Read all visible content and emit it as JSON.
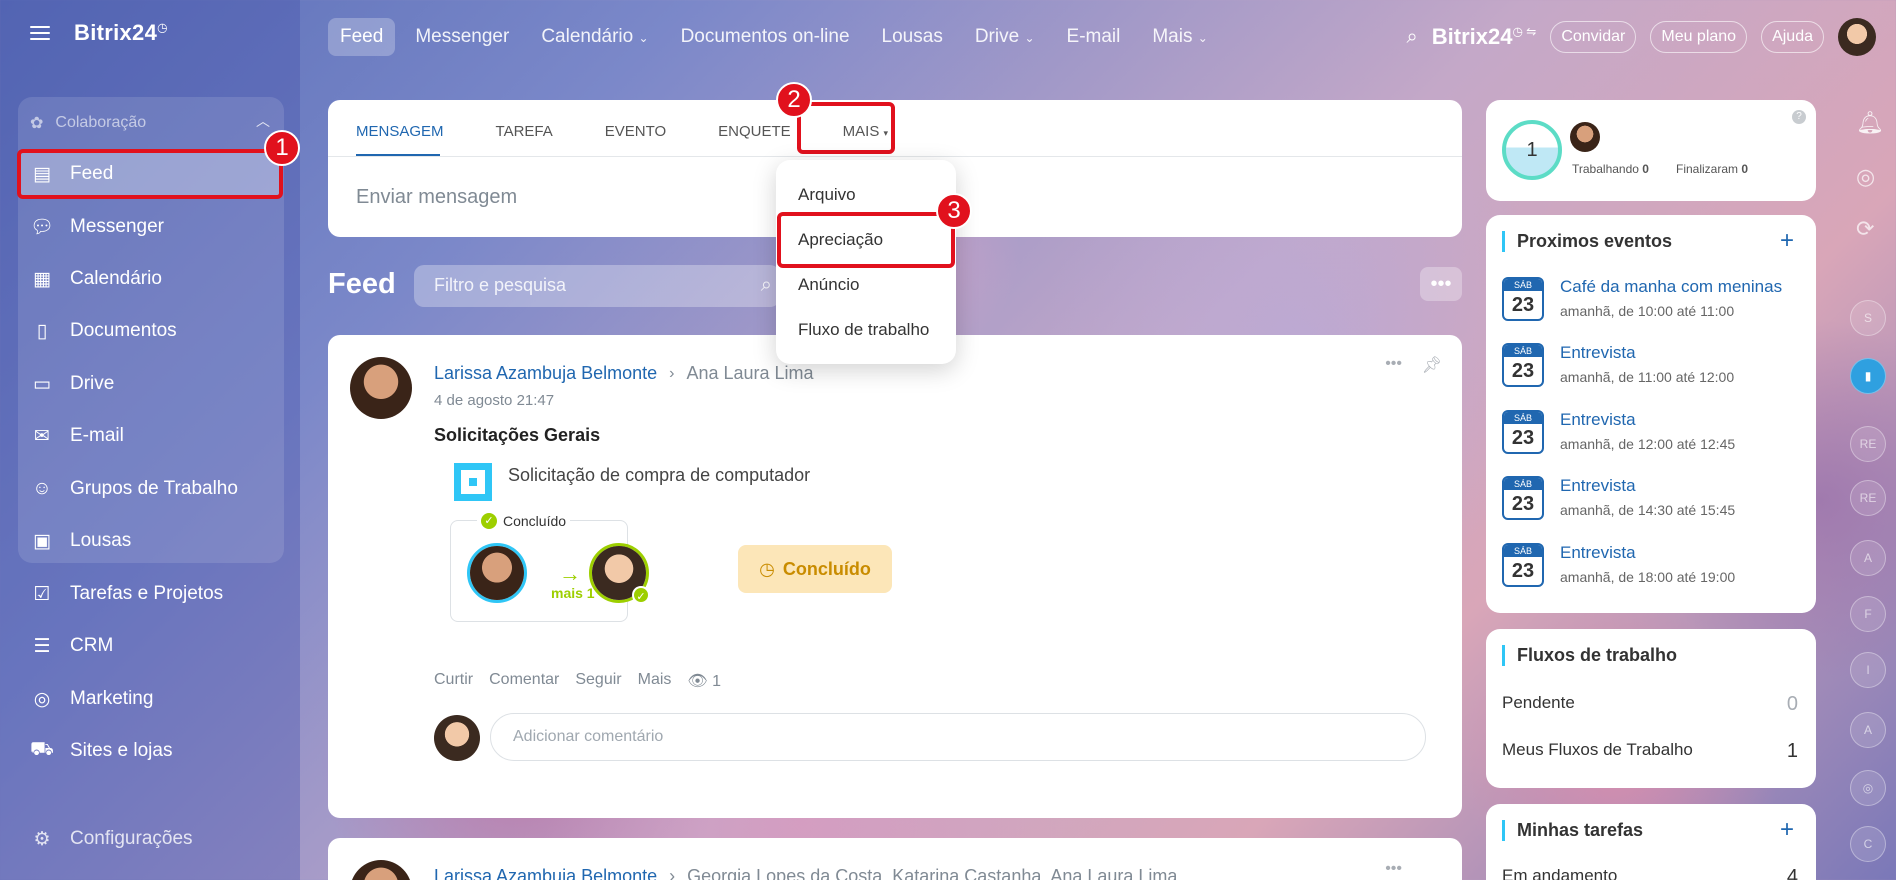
{
  "app": {
    "logo": "Bitrix24"
  },
  "sidebar": {
    "group_title": "Colaboração",
    "items": [
      {
        "label": "Feed"
      },
      {
        "label": "Messenger"
      },
      {
        "label": "Calendário"
      },
      {
        "label": "Documentos"
      },
      {
        "label": "Drive"
      },
      {
        "label": "E-mail"
      },
      {
        "label": "Grupos de Trabalho"
      },
      {
        "label": "Lousas"
      },
      {
        "label": "Tarefas e Projetos"
      },
      {
        "label": "CRM"
      },
      {
        "label": "Marketing"
      },
      {
        "label": "Sites e lojas"
      }
    ],
    "settings": "Configurações"
  },
  "topnav": {
    "items": [
      "Feed",
      "Messenger",
      "Calendário",
      "Documentos on-line",
      "Lousas",
      "Drive",
      "E-mail",
      "Mais"
    ],
    "logo": "Bitrix24",
    "invite": "Convidar",
    "plan": "Meu plano",
    "help": "Ajuda"
  },
  "composer": {
    "tabs": [
      "MENSAGEM",
      "TAREFA",
      "EVENTO",
      "ENQUETE",
      "MAIS"
    ],
    "placeholder": "Enviar mensagem"
  },
  "dropdown": {
    "items": [
      "Arquivo",
      "Apreciação",
      "Anúncio",
      "Fluxo de trabalho"
    ]
  },
  "callouts": [
    "1",
    "2",
    "3"
  ],
  "feed": {
    "title": "Feed",
    "search_placeholder": "Filtro e pesquisa",
    "post": {
      "author": "Larissa Azambuja Belmonte",
      "recipient": "Ana Laura Lima",
      "date": "4 de agosto 21:47",
      "title": "Solicitações Gerais",
      "item": "Solicitação de compra de computador",
      "status_card_label": "Concluído",
      "more_label": "mais 1",
      "status_badge": "Concluído",
      "actions": [
        "Curtir",
        "Comentar",
        "Seguir",
        "Mais"
      ],
      "views": "1",
      "comment_placeholder": "Adicionar comentário"
    },
    "post2": {
      "author": "Larissa Azambuja Belmonte",
      "recipients": "Georgia Lopes da Costa, Katarina Castanha, Ana Laura Lima"
    }
  },
  "worktime": {
    "count": "1",
    "working_label": "Trabalhando",
    "working": "0",
    "finished_label": "Finalizaram",
    "finished": "0"
  },
  "events": {
    "title": "Proximos eventos",
    "items": [
      {
        "weekday": "SÁB",
        "day": "23",
        "title": "Café da manha com meninas",
        "time": "amanhã, de 10:00 até 11:00"
      },
      {
        "weekday": "SÁB",
        "day": "23",
        "title": "Entrevista",
        "time": "amanhã, de 11:00 até 12:00"
      },
      {
        "weekday": "SÁB",
        "day": "23",
        "title": "Entrevista",
        "time": "amanhã, de 12:00 até 12:45"
      },
      {
        "weekday": "SÁB",
        "day": "23",
        "title": "Entrevista",
        "time": "amanhã, de 14:30 até 15:45"
      },
      {
        "weekday": "SÁB",
        "day": "23",
        "title": "Entrevista",
        "time": "amanhã, de 18:00 até 19:00"
      }
    ]
  },
  "flows": {
    "title": "Fluxos de trabalho",
    "rows": [
      {
        "label": "Pendente",
        "value": "0"
      },
      {
        "label": "Meus Fluxos de Trabalho",
        "value": "1"
      }
    ]
  },
  "tasks": {
    "title": "Minhas tarefas",
    "row_label": "Em andamento",
    "row_value": "4"
  },
  "rail": {
    "items": [
      "S",
      "RE",
      "RE",
      "A",
      "F",
      "I",
      "A",
      "C"
    ]
  }
}
